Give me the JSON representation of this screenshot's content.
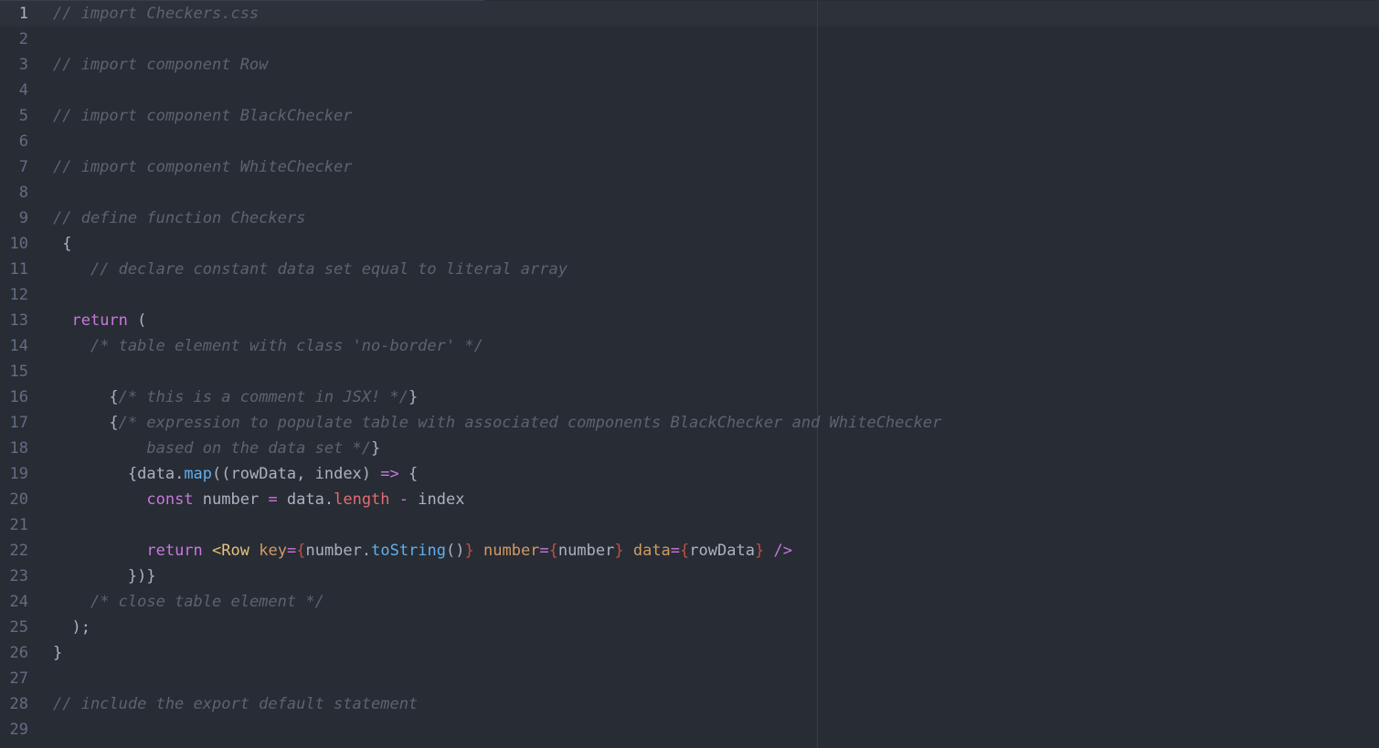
{
  "editor": {
    "lines": [
      {
        "num": "1",
        "indent": "",
        "tokens": [
          {
            "t": "comment",
            "v": "// import Checkers.css"
          }
        ]
      },
      {
        "num": "2",
        "indent": "",
        "tokens": []
      },
      {
        "num": "3",
        "indent": "",
        "tokens": [
          {
            "t": "comment",
            "v": "// import component Row"
          }
        ]
      },
      {
        "num": "4",
        "indent": "",
        "tokens": []
      },
      {
        "num": "5",
        "indent": "",
        "tokens": [
          {
            "t": "comment",
            "v": "// import component BlackChecker"
          }
        ]
      },
      {
        "num": "6",
        "indent": "",
        "tokens": []
      },
      {
        "num": "7",
        "indent": "",
        "tokens": [
          {
            "t": "comment",
            "v": "// import component WhiteChecker"
          }
        ]
      },
      {
        "num": "8",
        "indent": "",
        "tokens": []
      },
      {
        "num": "9",
        "indent": "",
        "tokens": [
          {
            "t": "comment",
            "v": "// define function Checkers"
          }
        ]
      },
      {
        "num": "10",
        "indent": " ",
        "tokens": [
          {
            "t": "plain",
            "v": "{"
          }
        ]
      },
      {
        "num": "11",
        "indent": "    ",
        "tokens": [
          {
            "t": "comment",
            "v": "// declare constant data set equal to literal array"
          }
        ]
      },
      {
        "num": "12",
        "indent": "",
        "tokens": []
      },
      {
        "num": "13",
        "indent": "  ",
        "tokens": [
          {
            "t": "kw",
            "v": "return"
          },
          {
            "t": "plain",
            "v": " ("
          }
        ]
      },
      {
        "num": "14",
        "indent": "    ",
        "tokens": [
          {
            "t": "comment",
            "v": "/* table element with class 'no-border' */"
          }
        ]
      },
      {
        "num": "15",
        "indent": "",
        "tokens": []
      },
      {
        "num": "16",
        "indent": "      ",
        "tokens": [
          {
            "t": "plain",
            "v": "{"
          },
          {
            "t": "comment",
            "v": "/* this is a comment in JSX! */"
          },
          {
            "t": "plain",
            "v": "}"
          }
        ]
      },
      {
        "num": "17",
        "indent": "      ",
        "tokens": [
          {
            "t": "plain",
            "v": "{"
          },
          {
            "t": "comment",
            "v": "/* expression to populate table with associated components BlackChecker and WhiteChecker"
          }
        ]
      },
      {
        "num": "18",
        "indent": "          ",
        "tokens": [
          {
            "t": "comment",
            "v": "based on the data set */"
          },
          {
            "t": "plain",
            "v": "}"
          }
        ]
      },
      {
        "num": "19",
        "indent": "        ",
        "tokens": [
          {
            "t": "plain",
            "v": "{data."
          },
          {
            "t": "fn",
            "v": "map"
          },
          {
            "t": "plain",
            "v": "((rowData, index) "
          },
          {
            "t": "op",
            "v": "=>"
          },
          {
            "t": "plain",
            "v": " {"
          }
        ]
      },
      {
        "num": "20",
        "indent": "          ",
        "tokens": [
          {
            "t": "kw",
            "v": "const"
          },
          {
            "t": "plain",
            "v": " number "
          },
          {
            "t": "op",
            "v": "="
          },
          {
            "t": "plain",
            "v": " data."
          },
          {
            "t": "prop",
            "v": "length"
          },
          {
            "t": "plain",
            "v": " "
          },
          {
            "t": "op",
            "v": "-"
          },
          {
            "t": "plain",
            "v": " index"
          }
        ]
      },
      {
        "num": "21",
        "indent": "",
        "tokens": []
      },
      {
        "num": "22",
        "indent": "          ",
        "tokens": [
          {
            "t": "kw",
            "v": "return"
          },
          {
            "t": "plain",
            "v": " "
          },
          {
            "t": "tag",
            "v": "<"
          },
          {
            "t": "tag",
            "v": "Row"
          },
          {
            "t": "plain",
            "v": " "
          },
          {
            "t": "attr",
            "v": "key"
          },
          {
            "t": "op",
            "v": "="
          },
          {
            "t": "brace",
            "v": "{"
          },
          {
            "t": "plain",
            "v": "number."
          },
          {
            "t": "fn",
            "v": "toString"
          },
          {
            "t": "plain",
            "v": "()"
          },
          {
            "t": "brace",
            "v": "}"
          },
          {
            "t": "plain",
            "v": " "
          },
          {
            "t": "attr",
            "v": "number"
          },
          {
            "t": "op",
            "v": "="
          },
          {
            "t": "brace",
            "v": "{"
          },
          {
            "t": "plain",
            "v": "number"
          },
          {
            "t": "brace",
            "v": "}"
          },
          {
            "t": "plain",
            "v": " "
          },
          {
            "t": "attr",
            "v": "data"
          },
          {
            "t": "op",
            "v": "="
          },
          {
            "t": "brace",
            "v": "{"
          },
          {
            "t": "plain",
            "v": "rowData"
          },
          {
            "t": "brace",
            "v": "}"
          },
          {
            "t": "plain",
            "v": " "
          },
          {
            "t": "op",
            "v": "/>"
          }
        ]
      },
      {
        "num": "23",
        "indent": "        ",
        "tokens": [
          {
            "t": "plain",
            "v": "})}"
          }
        ]
      },
      {
        "num": "24",
        "indent": "    ",
        "tokens": [
          {
            "t": "comment",
            "v": "/* close table element */"
          }
        ]
      },
      {
        "num": "25",
        "indent": "  ",
        "tokens": [
          {
            "t": "plain",
            "v": ");"
          }
        ]
      },
      {
        "num": "26",
        "indent": "",
        "tokens": [
          {
            "t": "plain",
            "v": "}"
          }
        ]
      },
      {
        "num": "27",
        "indent": "",
        "tokens": []
      },
      {
        "num": "28",
        "indent": "",
        "tokens": [
          {
            "t": "comment",
            "v": "// include the export default statement"
          }
        ]
      },
      {
        "num": "29",
        "indent": "",
        "tokens": []
      }
    ]
  },
  "colors": {
    "background": "#282c34",
    "current_line": "#2c313a",
    "comment": "#5c6370",
    "keyword": "#c678dd",
    "function": "#61afef",
    "property": "#e06c75",
    "tag": "#e5c07b",
    "attribute": "#d19a66"
  }
}
